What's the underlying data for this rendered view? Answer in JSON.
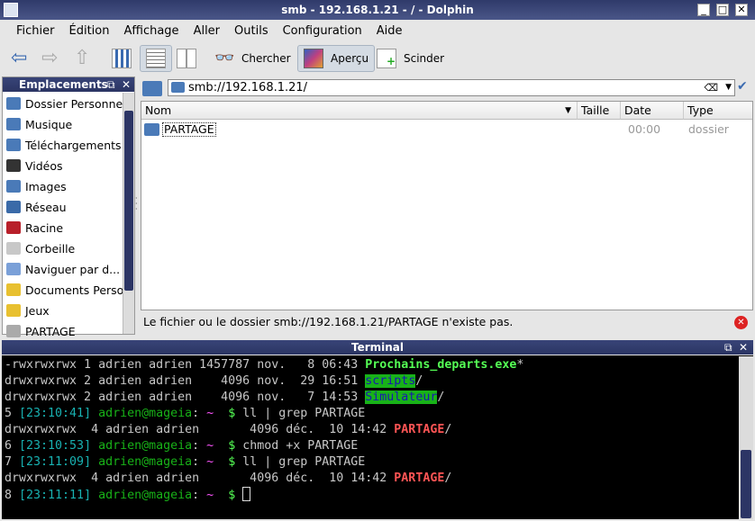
{
  "window": {
    "title": "smb - 192.168.1.21 - / - Dolphin"
  },
  "menu": [
    "Fichier",
    "Édition",
    "Affichage",
    "Aller",
    "Outils",
    "Configuration",
    "Aide"
  ],
  "toolbar": {
    "search": "Chercher",
    "preview": "Aperçu",
    "split": "Scinder"
  },
  "places": {
    "title": "Emplacements",
    "items": [
      {
        "label": "Dossier Personnel",
        "icon": "home-folder-icon",
        "color": "#4a7ab8"
      },
      {
        "label": "Musique",
        "icon": "music-folder-icon",
        "color": "#4a7ab8"
      },
      {
        "label": "Téléchargements",
        "icon": "download-folder-icon",
        "color": "#4a7ab8"
      },
      {
        "label": "Vidéos",
        "icon": "video-icon",
        "color": "#333333"
      },
      {
        "label": "Images",
        "icon": "images-folder-icon",
        "color": "#4a7ab8"
      },
      {
        "label": "Réseau",
        "icon": "network-icon",
        "color": "#3a6aa8"
      },
      {
        "label": "Racine",
        "icon": "root-folder-icon",
        "color": "#b8202a"
      },
      {
        "label": "Corbeille",
        "icon": "trash-icon",
        "color": "#c8c8c8"
      },
      {
        "label": "Naviguer par d...",
        "icon": "timeline-icon",
        "color": "#7aa0d8"
      },
      {
        "label": "Documents Perso",
        "icon": "star-icon",
        "color": "#e8c030"
      },
      {
        "label": "Jeux",
        "icon": "star-icon",
        "color": "#e8c030"
      },
      {
        "label": "PARTAGE",
        "icon": "drive-icon",
        "color": "#aaaaaa"
      }
    ]
  },
  "location": {
    "url": "smb://192.168.1.21/"
  },
  "columns": [
    "Nom",
    "Taille",
    "Date",
    "Type"
  ],
  "files": [
    {
      "name": "PARTAGE",
      "size": "",
      "date": "00:00",
      "type": "dossier"
    }
  ],
  "status": {
    "message": "Le fichier ou le dossier smb://192.168.1.21/PARTAGE n'existe pas."
  },
  "terminal": {
    "title": "Terminal",
    "lines": [
      [
        [
          "g",
          "-rwxrwxrwx 1 adrien adrien 1457787 nov.   8 06:43 "
        ],
        [
          "bg",
          "Prochains_departs.exe"
        ],
        [
          "g",
          "*"
        ]
      ],
      [
        [
          "g",
          "drwxrwxrwx 2 adrien adrien    4096 nov.  29 16:51 "
        ],
        [
          "hl",
          "scripts"
        ],
        [
          "g",
          "/"
        ]
      ],
      [
        [
          "g",
          "drwxrwxrwx 2 adrien adrien    4096 nov.   7 14:53 "
        ],
        [
          "hl",
          "Simulateur"
        ],
        [
          "g",
          "/"
        ]
      ],
      [
        [
          "g",
          "5 "
        ],
        [
          "cy",
          "[23:10:41]"
        ],
        [
          "gr",
          " adrien@mageia"
        ],
        [
          "g",
          ": "
        ],
        [
          "mg",
          "~"
        ],
        [
          "ds",
          "  $"
        ],
        [
          "g",
          " ll | grep PARTAGE"
        ]
      ],
      [
        [
          "g",
          "drwxrwxrwx  4 adrien adrien       4096 déc.  10 14:42 "
        ],
        [
          "rd",
          "PARTAGE"
        ],
        [
          "g",
          "/"
        ]
      ],
      [
        [
          "g",
          "6 "
        ],
        [
          "cy",
          "[23:10:53]"
        ],
        [
          "gr",
          " adrien@mageia"
        ],
        [
          "g",
          ": "
        ],
        [
          "mg",
          "~"
        ],
        [
          "ds",
          "  $"
        ],
        [
          "g",
          " chmod +x PARTAGE"
        ]
      ],
      [
        [
          "g",
          "7 "
        ],
        [
          "cy",
          "[23:11:09]"
        ],
        [
          "gr",
          " adrien@mageia"
        ],
        [
          "g",
          ": "
        ],
        [
          "mg",
          "~"
        ],
        [
          "ds",
          "  $"
        ],
        [
          "g",
          " ll | grep PARTAGE"
        ]
      ],
      [
        [
          "g",
          "drwxrwxrwx  4 adrien adrien       4096 déc.  10 14:42 "
        ],
        [
          "rd",
          "PARTAGE"
        ],
        [
          "g",
          "/"
        ]
      ],
      [
        [
          "g",
          "8 "
        ],
        [
          "cy",
          "[23:11:11]"
        ],
        [
          "gr",
          " adrien@mageia"
        ],
        [
          "g",
          ": "
        ],
        [
          "mg",
          "~"
        ],
        [
          "ds",
          "  $ "
        ]
      ]
    ]
  }
}
